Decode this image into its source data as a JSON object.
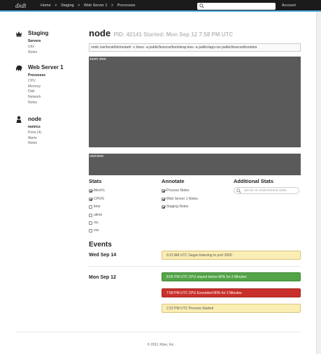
{
  "topbar": {
    "logo": "dxdt",
    "breadcrumbs": [
      "Home",
      ">",
      "Staging",
      ">",
      "Web Server 1",
      ">",
      "Processes"
    ],
    "account": "Account",
    "accent_color": "#5bb4e6"
  },
  "sidebar": {
    "groups": [
      {
        "icon": "crown-icon",
        "title": "Staging",
        "items": [
          "Servers",
          "Urls",
          "Notes"
        ],
        "active": "Servers"
      },
      {
        "icon": "elephant-icon",
        "title": "Web Server 1",
        "items": [
          "Processes",
          "CPU",
          "Memory",
          "Disk",
          "Network",
          "Notes"
        ],
        "active": "Processes"
      },
      {
        "icon": "person-icon",
        "title": "node",
        "items": [
          "metrics",
          "Ports (4)",
          "Alerts",
          "Notes"
        ],
        "active": "metrics"
      }
    ]
  },
  "header": {
    "name": "node",
    "meta": "PID: 42141   Started: Mon Sep 12 7:58 PM UTC"
  },
  "command_line": "node /usr/local/bin/restartr -c lessc -a public/lesscss/bootstrap.less -a public/app.css public/lesscss/bootstra",
  "panels": {
    "zoom_label": "zoom view",
    "overview_label": "overview"
  },
  "stats": {
    "title": "Stats",
    "items": [
      {
        "label": "Mem%",
        "checked": true
      },
      {
        "label": "CPU%",
        "checked": true
      },
      {
        "label": "time",
        "checked": false
      },
      {
        "label": "utime",
        "checked": false
      },
      {
        "label": "rss",
        "checked": false
      },
      {
        "label": "vsz",
        "checked": false
      }
    ]
  },
  "annotate": {
    "title": "Annotate",
    "items": [
      {
        "label": "Process Notes",
        "checked": true
      },
      {
        "label": "Web Server 1 Notes",
        "checked": true
      },
      {
        "label": "Staging Notes",
        "checked": true
      }
    ]
  },
  "additional_stats": {
    "title": "Additional Stats",
    "placeholder": "server or environment stats"
  },
  "events": {
    "title": "Events",
    "days": [
      {
        "label": "Wed Sep 14",
        "entries": [
          {
            "text": "9:22 AM UTC Segan listening to port 3000",
            "status": "yellow"
          }
        ]
      },
      {
        "label": "Mon Sep 12",
        "entries": [
          {
            "text": "8:05 PM UTC CPU stayed below 80% for 2 Minutes",
            "status": "green"
          },
          {
            "text": "7:58 PM UTC CPU Exceeded 80% for 2 Minutes",
            "status": "red"
          },
          {
            "text": "2:22 PM UTC Process Started",
            "status": "yellow"
          }
        ]
      }
    ],
    "colors": {
      "yellow": "#fbeeb4",
      "green": "#52a447",
      "red": "#c9302c"
    }
  },
  "footer": {
    "text": "© 2011 Xtive, Inc"
  }
}
